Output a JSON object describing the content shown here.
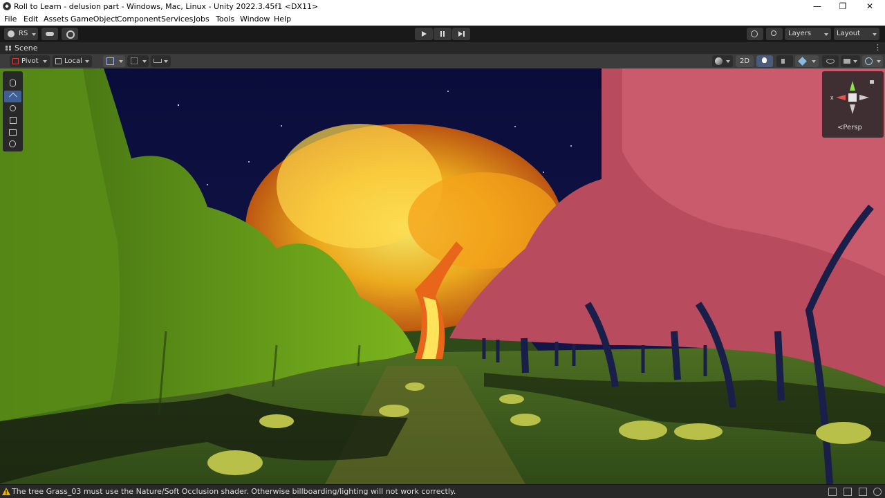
{
  "window": {
    "title": "Roll to Learn - delusion part - Windows, Mac, Linux - Unity 2022.3.45f1 <DX11>",
    "minimize_glyph": "—",
    "maximize_glyph": "❐",
    "close_glyph": "✕"
  },
  "menu": {
    "file": "File",
    "edit": "Edit",
    "assets": "Assets",
    "gameobject": "GameObject",
    "component": "Component",
    "services": "Services",
    "jobs": "Jobs",
    "tools": "Tools",
    "window": "Window",
    "help": "Help"
  },
  "toolbar": {
    "account_label": "RS",
    "layers_label": "Layers",
    "layout_label": "Layout"
  },
  "scene_tab": {
    "label": "Scene",
    "more_glyph": "⋮"
  },
  "scene_toolbar": {
    "pivot_label": "Pivot",
    "local_label": "Local",
    "mode_2d_label": "2D"
  },
  "gizmo": {
    "projection_label": "<Persp"
  },
  "status": {
    "message": "The tree Grass_03 must use the Nature/Soft Occlusion shader. Otherwise billboarding/lighting will not work correctly."
  },
  "colors": {
    "editor_bg": "#191919",
    "panel": "#282828",
    "button": "#383838",
    "accent_blue": "#3e5f96",
    "warning_yellow": "#f0b400"
  }
}
